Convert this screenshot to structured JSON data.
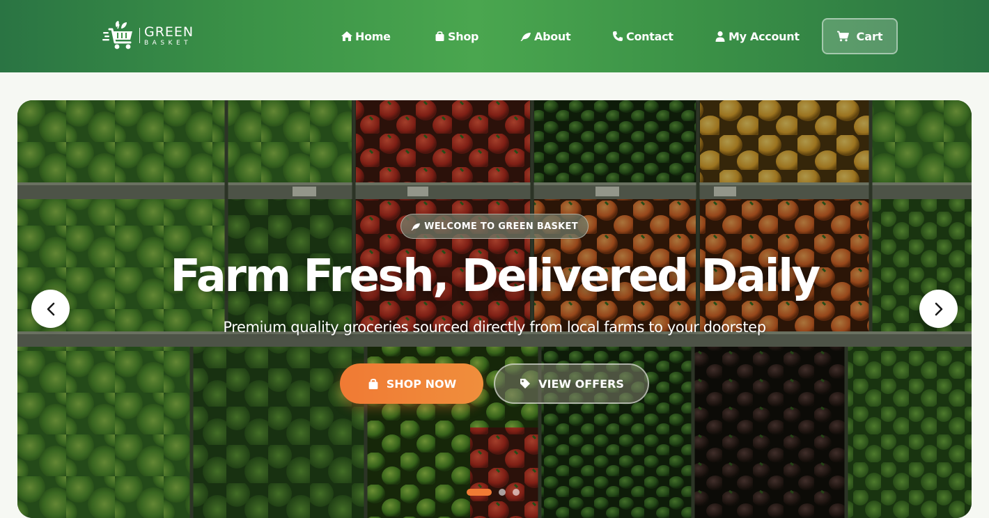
{
  "brand": {
    "name_top": "GREEN",
    "name_bottom": "BASKET"
  },
  "nav": {
    "items": [
      {
        "label": "Home",
        "icon": "home-icon"
      },
      {
        "label": "Shop",
        "icon": "shopping-bag-icon"
      },
      {
        "label": "About",
        "icon": "leaf-icon"
      },
      {
        "label": "Contact",
        "icon": "phone-icon"
      },
      {
        "label": "My Account",
        "icon": "user-icon"
      }
    ],
    "cart_label": "Cart"
  },
  "hero": {
    "badge": "WELCOME TO GREEN BASKET",
    "title": "Farm Fresh, Delivered Daily",
    "subtitle": "Premium quality groceries sourced directly from local farms to your doorstep",
    "primary_button": "SHOP NOW",
    "secondary_button": "VIEW OFFERS",
    "slides_total": 3,
    "active_slide": 1
  },
  "colors": {
    "header_green": "#3b9247",
    "accent_orange": "#f07a34",
    "white": "#ffffff"
  }
}
